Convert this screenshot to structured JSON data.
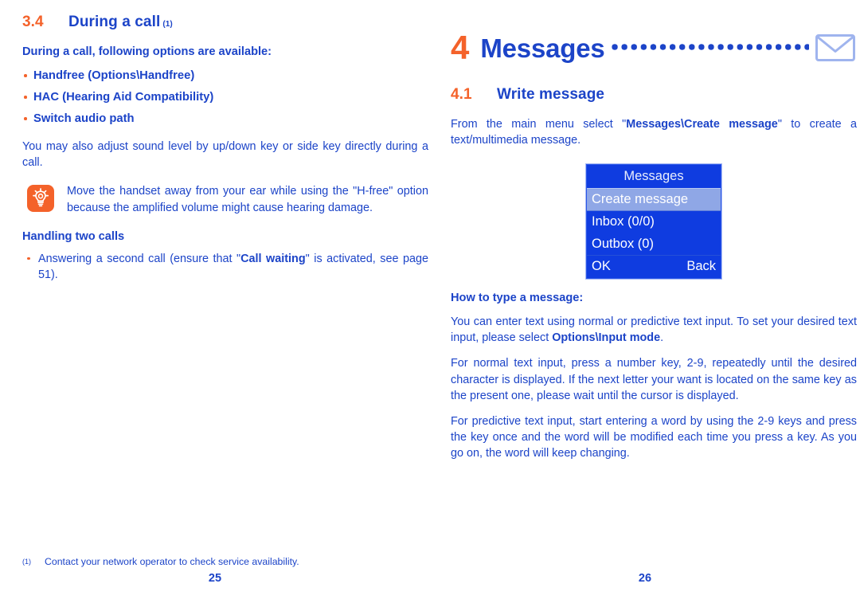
{
  "document": {
    "type": "mobile-phone-user-manual-spread"
  },
  "colors": {
    "blue": "#1c44c8",
    "orange": "#f4622a",
    "screen_blue": "#0f3ce0",
    "screen_highlight": "#8fa7e6"
  },
  "left_page": {
    "section": {
      "number": "3.4",
      "title": "During a call",
      "footnote_marker": "(1)"
    },
    "intro_bold": "During a call, following options are available:",
    "options": [
      "Handfree (Options\\Handfree)",
      "HAC (Hearing Aid Compatibility)",
      "Switch audio path"
    ],
    "paragraph_1": "You may also adjust sound level by up/down key or side key directly during a call.",
    "tip": {
      "icon": "lightbulb-icon",
      "text_part_1": "Move the handset away from your ear while using the \"H-free\" option because the amplified volume might cause hearing damage."
    },
    "handling": {
      "heading": "Handling two calls",
      "item_pre": "Answering a second call (ensure that \"",
      "item_bold": "Call waiting",
      "item_post": "\" is activated, see page 51)."
    },
    "footnote": {
      "marker": "(1)",
      "text": "Contact your network operator to check service availability."
    },
    "page_number": "25"
  },
  "right_page": {
    "chapter": {
      "number": "4",
      "title": "Messages",
      "leader": "........................",
      "icon": "envelope-icon"
    },
    "section": {
      "number": "4.1",
      "title": "Write message"
    },
    "intro": {
      "pre": "From the main menu select \"",
      "bold": "Messages\\Create message",
      "post": "\" to create a text/multimedia message."
    },
    "phone_screen": {
      "title": "Messages",
      "items": [
        {
          "label": "Create message",
          "selected": true
        },
        {
          "label": "Inbox (0/0)",
          "selected": false
        },
        {
          "label": "Outbox (0)",
          "selected": false
        }
      ],
      "softkey_left": "OK",
      "softkey_right": "Back"
    },
    "howto": {
      "heading": "How to type a message:",
      "p1_pre": "You can enter text using normal or predictive text input. To set your desired text input, please select ",
      "p1_bold": "Options\\Input mode",
      "p1_post": ".",
      "p2": "For normal text input, press a number key, 2-9, repeatedly until the desired character is displayed. If the next letter your want is located on the same key as the present one, please wait until the cursor is displayed.",
      "p3": "For predictive text input,  start entering a word by using the 2-9 keys and press the key once and the word will be modified each time you press a key. As you go on, the word will keep changing."
    },
    "page_number": "26"
  }
}
